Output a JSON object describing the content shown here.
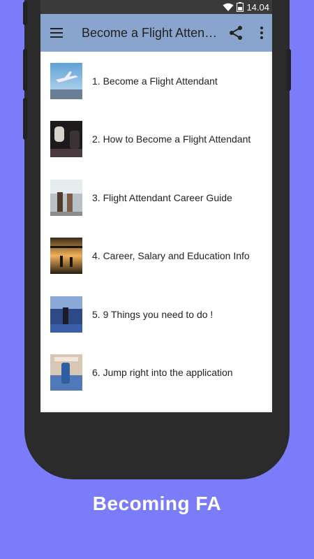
{
  "status": {
    "time": "14.04"
  },
  "appbar": {
    "title": "Become a Flight Attendant"
  },
  "items": [
    {
      "label": "1. Become a Flight Attendant"
    },
    {
      "label": "2. How to Become a Flight Attendant"
    },
    {
      "label": "3. Flight Attendant Career Guide"
    },
    {
      "label": "4. Career, Salary and Education Info"
    },
    {
      "label": "5. 9 Things you need to do !"
    },
    {
      "label": "6. Jump right into the application"
    }
  ],
  "footer": {
    "brand": "Becoming FA"
  },
  "colors": {
    "background": "#7b7cf9",
    "appbar": "#8aa5cd"
  }
}
